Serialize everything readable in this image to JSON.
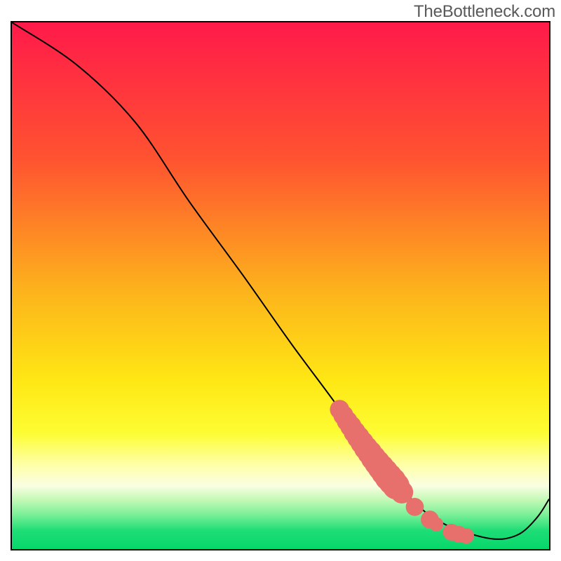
{
  "watermark": "TheBottleneck.com",
  "chart_data": {
    "type": "line",
    "title": "",
    "xlabel": "",
    "ylabel": "",
    "xlim": [
      0,
      100
    ],
    "ylim": [
      0,
      100
    ],
    "background_gradient": {
      "stops": [
        {
          "pct": 0.0,
          "color": "#ff1a4a"
        },
        {
          "pct": 0.26,
          "color": "#ff5330"
        },
        {
          "pct": 0.51,
          "color": "#fdb31c"
        },
        {
          "pct": 0.68,
          "color": "#fee714"
        },
        {
          "pct": 0.78,
          "color": "#fdfd33"
        },
        {
          "pct": 0.84,
          "color": "#feffa8"
        },
        {
          "pct": 0.88,
          "color": "#fafee2"
        },
        {
          "pct": 0.905,
          "color": "#c6f9b8"
        },
        {
          "pct": 0.935,
          "color": "#7aef98"
        },
        {
          "pct": 0.965,
          "color": "#1edd76"
        },
        {
          "pct": 1.0,
          "color": "#06d76b"
        }
      ]
    },
    "series": [
      {
        "name": "bottleneck-curve",
        "color": "#000000",
        "stroke_width": 2,
        "x": [
          0,
          12,
          23,
          33,
          43,
          52,
          60,
          67,
          73,
          77,
          81,
          85,
          89,
          92,
          95,
          98,
          100
        ],
        "values": [
          100,
          92,
          81,
          66,
          52,
          39,
          28,
          18,
          11,
          7,
          4.5,
          3,
          2,
          2,
          3.2,
          6.3,
          9.5
        ]
      }
    ],
    "markers": {
      "name": "highlight-segment",
      "color": "#e76f6c",
      "points": [
        {
          "x": 61,
          "y": 26.5,
          "r": 3.0
        },
        {
          "x": 61.7,
          "y": 25.4,
          "r": 3.1
        },
        {
          "x": 62.4,
          "y": 24.3,
          "r": 3.2
        },
        {
          "x": 63.1,
          "y": 23.3,
          "r": 3.3
        },
        {
          "x": 63.8,
          "y": 22.2,
          "r": 3.4
        },
        {
          "x": 64.5,
          "y": 21.2,
          "r": 3.5
        },
        {
          "x": 65.2,
          "y": 20.2,
          "r": 3.6
        },
        {
          "x": 65.9,
          "y": 19.2,
          "r": 3.7
        },
        {
          "x": 66.6,
          "y": 18.3,
          "r": 3.8
        },
        {
          "x": 67.3,
          "y": 17.3,
          "r": 3.9
        },
        {
          "x": 68.0,
          "y": 16.4,
          "r": 4.0
        },
        {
          "x": 68.7,
          "y": 15.5,
          "r": 4.1
        },
        {
          "x": 69.4,
          "y": 14.6,
          "r": 4.2
        },
        {
          "x": 70.1,
          "y": 13.7,
          "r": 4.3
        },
        {
          "x": 70.8,
          "y": 12.9,
          "r": 4.3
        },
        {
          "x": 71.5,
          "y": 12.0,
          "r": 4.2
        },
        {
          "x": 72.6,
          "y": 10.8,
          "r": 3.5
        },
        {
          "x": 75.0,
          "y": 8.0,
          "r": 2.8
        },
        {
          "x": 77.8,
          "y": 5.6,
          "r": 2.8
        },
        {
          "x": 79.0,
          "y": 4.7,
          "r": 2.2
        },
        {
          "x": 81.8,
          "y": 3.2,
          "r": 2.6
        },
        {
          "x": 83.2,
          "y": 2.8,
          "r": 2.6
        },
        {
          "x": 84.6,
          "y": 2.5,
          "r": 2.4
        }
      ]
    }
  }
}
